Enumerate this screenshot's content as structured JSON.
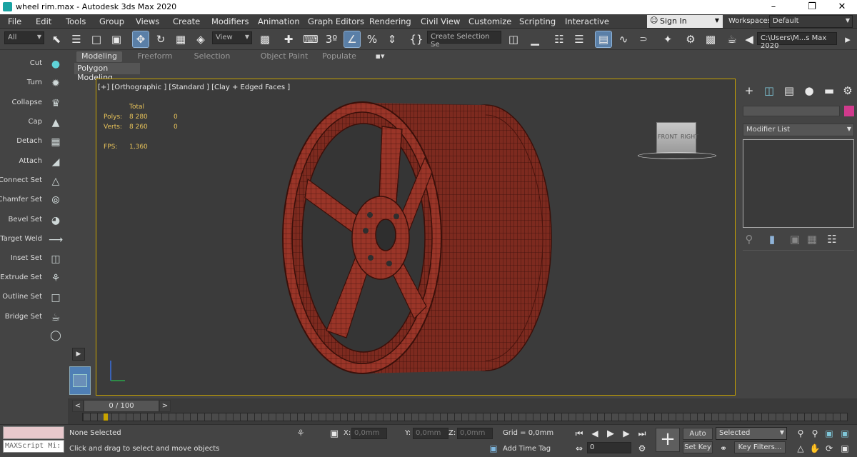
{
  "window": {
    "title": "wheel rim.max - Autodesk 3ds Max 2020"
  },
  "window_controls": {
    "minimize": "–",
    "maximize": "❐",
    "close": "✕"
  },
  "menu": {
    "items": [
      "File",
      "Edit",
      "Tools",
      "Group",
      "Views",
      "Create",
      "Modifiers",
      "Animation",
      "Graph Editors",
      "Rendering",
      "Civil View",
      "Customize",
      "Scripting",
      "Interactive"
    ],
    "sign_in": "Sign In",
    "workspaces_label": "Workspaces:",
    "workspace_value": "Default"
  },
  "toolbar": {
    "filter_value": "All",
    "ref_coord_value": "View",
    "selection_set_placeholder": "Create Selection Se",
    "project_path": "C:\\Users\\M...s Max 2020"
  },
  "ribbon": {
    "tabs": [
      "Modeling",
      "Freeform",
      "Selection",
      "Object Paint",
      "Populate"
    ],
    "active_tab": "Modeling",
    "subpanel": "Polygon Modeling"
  },
  "left_panel": {
    "items": [
      "Cut",
      "Turn",
      "Collapse",
      "Cap",
      "Detach",
      "Attach",
      "Connect Set",
      "Chamfer Set",
      "Bevel Set",
      "Target Weld",
      "Inset Set",
      "Extrude Set",
      "Outline Set",
      "Bridge Set"
    ]
  },
  "viewport": {
    "label": "[+] [Orthographic ] [Standard ] [Clay + Edged Faces ]",
    "stats": {
      "header": "Total",
      "polys_label": "Polys:",
      "polys_total": "8 280",
      "polys_sel": "0",
      "verts_label": "Verts:",
      "verts_total": "8 260",
      "verts_sel": "0",
      "fps_label": "FPS:",
      "fps_value": "1,360"
    },
    "viewcube": {
      "front": "FRONT",
      "right": "RIGHT"
    }
  },
  "command_panel": {
    "modifier_list": "Modifier List",
    "color_swatch": "#d03a8c"
  },
  "timeline": {
    "frame": "0 / 100",
    "prev": "<",
    "next": ">"
  },
  "status": {
    "selection": "None Selected",
    "prompt": "Click and drag to select and move objects",
    "maxscript": "MAXScript Mi:",
    "x_label": "X:",
    "x_value": "0,0mm",
    "y_label": "Y:",
    "y_value": "0,0mm",
    "z_label": "Z:",
    "z_value": "0,0mm",
    "grid": "Grid = 0,0mm",
    "add_time_tag": "Add Time Tag",
    "auto_key": "Auto Key",
    "set_key": "Set Key",
    "selected_value": "Selected",
    "key_filters": "Key Filters...",
    "frame_value": "0"
  },
  "colors": {
    "wheel": "#9a3528",
    "viewport_border": "#c9a400",
    "stats_text": "#e8c35a",
    "active_tool": "#5a7fa7"
  }
}
